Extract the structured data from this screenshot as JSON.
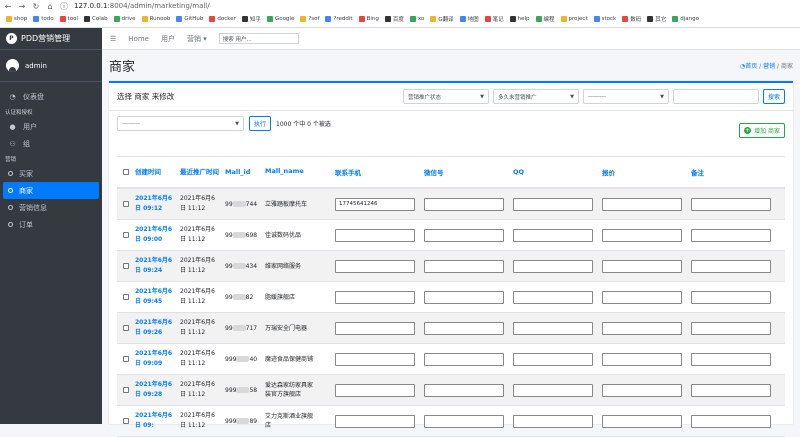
{
  "browser": {
    "url_host": "127.0.0.1",
    "url_rest": ":8004/admin/marketing/mall/",
    "bookmarks": [
      "shop",
      "todo",
      "tool",
      "Colab",
      "drive",
      "Runoob",
      "GitHub",
      "docker",
      "知乎",
      "Google",
      "?sof",
      "?reddit",
      "Bing",
      "百度",
      "xo",
      "G翻译",
      "地图",
      "笔记",
      "help",
      "编程",
      "project",
      "stock",
      "数码",
      "其它",
      "django"
    ]
  },
  "brand": "PDD营销管理",
  "user": "admin",
  "menu": {
    "dashboard": "仪表盘",
    "auth_header": "认证和授权",
    "users": "用户",
    "groups": "组",
    "mkt_header": "营销",
    "buyers": "买家",
    "merchants": "商家",
    "mkt_info": "营销信息",
    "orders": "订单"
  },
  "topbar": {
    "home": "Home",
    "users": "用户",
    "marketing": "营销",
    "search_placeholder": "搜索 用户..."
  },
  "page": {
    "title": "商家",
    "crumb_home": "首页",
    "crumb_sep": "/",
    "crumb_mkt": "营销",
    "crumb_cur": "商家"
  },
  "toolbar": {
    "select_prompt": "选择 商家 来修改",
    "f1": "营销推广状态",
    "f2": "多久未营销推广",
    "f3": "---------",
    "search": "搜索",
    "action": "---------",
    "go": "执行",
    "count": "1000 个中 0 个被选",
    "add": "增加 商家"
  },
  "columns": [
    "创建时间",
    "最近推广时间",
    "Mall_id",
    "Mall_name",
    "联系手机",
    "微信号",
    "QQ",
    "报价",
    "备注"
  ],
  "rows": [
    {
      "created": [
        "2021年6月6",
        "日 09:12"
      ],
      "recent": [
        "2021年6月6",
        "日 11:12"
      ],
      "mid_a": "99",
      "mid_b": "744",
      "name": [
        "立雅踏板摩托车"
      ],
      "phone": "17745641246"
    },
    {
      "created": [
        "2021年6月6",
        "日 09:00"
      ],
      "recent": [
        "2021年6月6",
        "日 11:12"
      ],
      "mid_a": "99",
      "mid_b": "698",
      "name": [
        "佳诚数码优品"
      ],
      "phone": ""
    },
    {
      "created": [
        "2021年6月6",
        "日 09:24"
      ],
      "recent": [
        "2021年6月6",
        "日 11:12"
      ],
      "mid_a": "99",
      "mid_b": "434",
      "name": [
        "维家网络服务"
      ],
      "phone": ""
    },
    {
      "created": [
        "2021年6月6",
        "日 09:45"
      ],
      "recent": [
        "2021年6月6",
        "日 11:12"
      ],
      "mid_a": "99",
      "mid_b": "82",
      "name": [
        "脂媛旗舰店"
      ],
      "phone": ""
    },
    {
      "created": [
        "2021年6月6",
        "日 09:26"
      ],
      "recent": [
        "2021年6月6",
        "日 11:12"
      ],
      "mid_a": "99",
      "mid_b": "717",
      "name": [
        "万瑞安全门电器"
      ],
      "phone": ""
    },
    {
      "created": [
        "2021年6月6",
        "日 09:09"
      ],
      "recent": [
        "2021年6月6",
        "日 11:12"
      ],
      "mid_a": "999",
      "mid_b": "40",
      "name": [
        "魔迹食品保健商铺"
      ],
      "phone": ""
    },
    {
      "created": [
        "2021年6月6",
        "日 09:28"
      ],
      "recent": [
        "2021年6月6",
        "日 11:12"
      ],
      "mid_a": "999",
      "mid_b": "58",
      "name": [
        "爱达森家纺家具家",
        "装官方旗舰店"
      ],
      "phone": ""
    },
    {
      "created": [
        "2021年6月6",
        "日 09:"
      ],
      "recent": [
        "2021年6月6",
        "日 11:12"
      ],
      "mid_a": "999",
      "mid_b": "89",
      "name": [
        "艾力克斯酒业旗舰",
        "店"
      ],
      "phone": ""
    }
  ]
}
